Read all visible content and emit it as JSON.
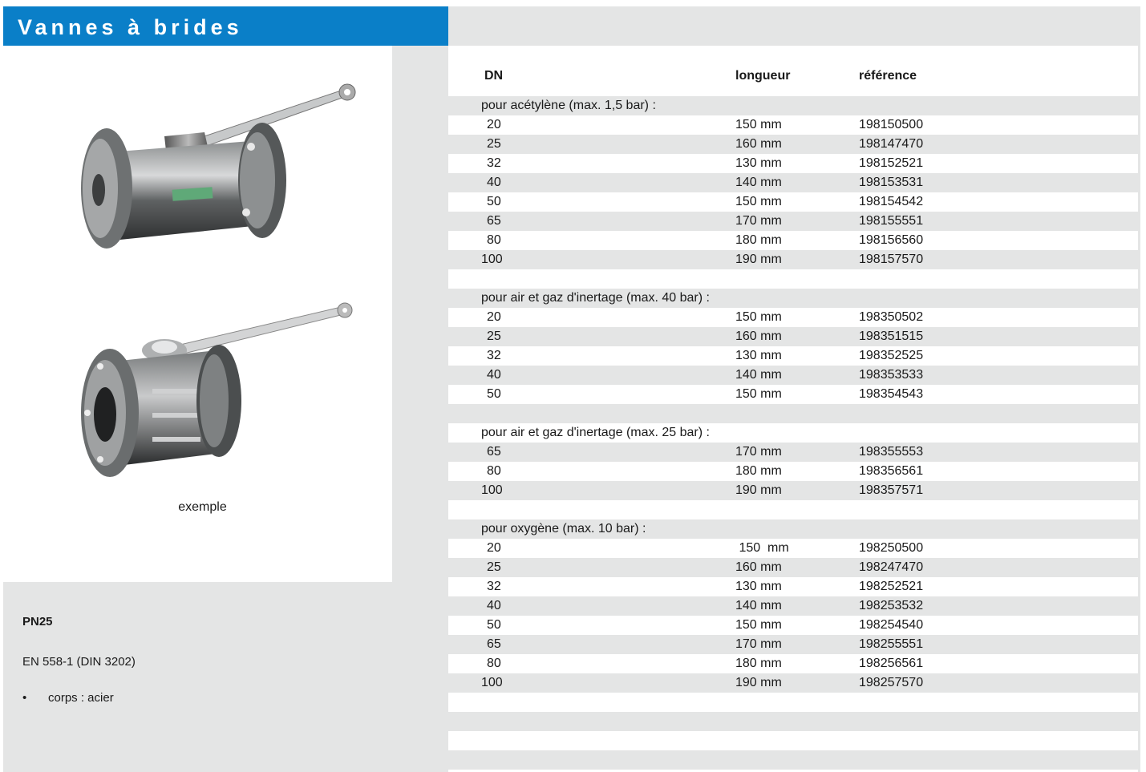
{
  "title": "Vannes à brides",
  "caption": "exemple",
  "info": {
    "pressure": "PN25",
    "norm": "EN 558-1 (DIN 3202)",
    "bullet_mark": "•",
    "body": "corps : acier"
  },
  "table": {
    "headers": {
      "dn": "DN",
      "length": "longueur",
      "reference": "référence"
    },
    "sections": [
      {
        "title": "pour acétylène (max. 1,5 bar) :",
        "rows": [
          {
            "dn": "20",
            "length": "150 mm",
            "reference": "198150500"
          },
          {
            "dn": "25",
            "length": "160 mm",
            "reference": "198147470"
          },
          {
            "dn": "32",
            "length": "130 mm",
            "reference": "198152521"
          },
          {
            "dn": "40",
            "length": "140 mm",
            "reference": "198153531"
          },
          {
            "dn": "50",
            "length": "150 mm",
            "reference": "198154542"
          },
          {
            "dn": "65",
            "length": "170 mm",
            "reference": "198155551"
          },
          {
            "dn": "80",
            "length": "180 mm",
            "reference": "198156560"
          },
          {
            "dn": "100",
            "length": "190 mm",
            "reference": "198157570"
          }
        ]
      },
      {
        "title": "pour air et gaz d'inertage (max. 40 bar) :",
        "rows": [
          {
            "dn": "20",
            "length": "150 mm",
            "reference": "198350502"
          },
          {
            "dn": "25",
            "length": "160 mm",
            "reference": "198351515"
          },
          {
            "dn": "32",
            "length": "130 mm",
            "reference": "198352525"
          },
          {
            "dn": "40",
            "length": "140 mm",
            "reference": "198353533"
          },
          {
            "dn": "50",
            "length": "150 mm",
            "reference": "198354543"
          }
        ]
      },
      {
        "title": "pour air et gaz d'inertage (max. 25 bar) :",
        "rows": [
          {
            "dn": "65",
            "length": "170 mm",
            "reference": "198355553"
          },
          {
            "dn": "80",
            "length": "180 mm",
            "reference": "198356561"
          },
          {
            "dn": "100",
            "length": "190 mm",
            "reference": "198357571"
          }
        ]
      },
      {
        "title": "pour oxygène (max. 10 bar) :",
        "rows": [
          {
            "dn": "20",
            "length": " 150  mm",
            "reference": "198250500"
          },
          {
            "dn": "25",
            "length": "160 mm",
            "reference": "198247470"
          },
          {
            "dn": "32",
            "length": "130 mm",
            "reference": "198252521"
          },
          {
            "dn": "40",
            "length": "140 mm",
            "reference": "198253532"
          },
          {
            "dn": "50",
            "length": "150 mm",
            "reference": "198254540"
          },
          {
            "dn": "65",
            "length": "170 mm",
            "reference": "198255551"
          },
          {
            "dn": "80",
            "length": "180 mm",
            "reference": "198256561"
          },
          {
            "dn": "100",
            "length": "190 mm",
            "reference": "198257570"
          }
        ]
      }
    ]
  },
  "colors": {
    "title_bg": "#0a7fc8",
    "panel_grey": "#e4e5e5"
  },
  "images": [
    "flanged-ball-valve",
    "split-body-flanged-ball-valve"
  ]
}
